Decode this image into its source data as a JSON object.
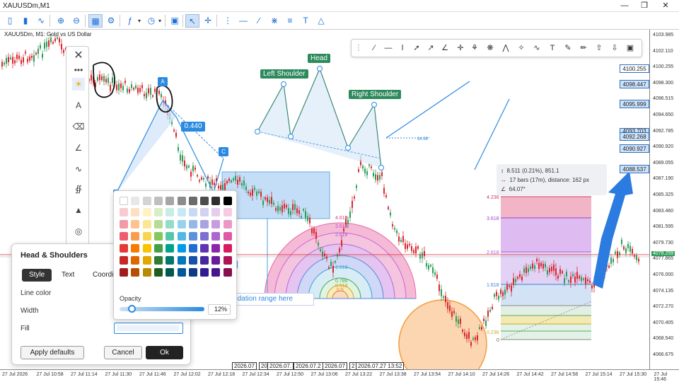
{
  "window": {
    "title": "XAUUSDm,M1"
  },
  "chart": {
    "title": "XAUUSDm, M1:  Gold vs US Dollar"
  },
  "price_axis": {
    "labels": [
      "4103.985",
      "4102.110",
      "4100.255",
      "4098.300",
      "4096.515",
      "4094.650",
      "4092.785",
      "4090.920",
      "4089.055",
      "4087.190",
      "4085.325",
      "4083.460",
      "4081.595",
      "4079.730",
      "4077.865",
      "4076.000",
      "4074.135",
      "4072.270",
      "4070.405",
      "4068.540",
      "4066.675"
    ]
  },
  "price_tags": [
    "4100.255",
    "4098.447",
    "4095.999",
    "4093.703",
    "4092.268",
    "4090.927",
    "4088.537"
  ],
  "current_price": "4078.259",
  "time_axis": {
    "labels": [
      "27 Jul 2026",
      "27 Jul 10:58",
      "27 Jul 11:14",
      "27 Jul 11:30",
      "27 Jul 11:46",
      "27 Jul 12:02",
      "27 Jul 12:18",
      "27 Jul 12:34",
      "27 Jul 12:50",
      "27 Jul 13:06",
      "27 Jul 13:22",
      "27 Jul 13:38",
      "27 Jul 13:54",
      "27 Jul 14:10",
      "27 Jul 14:26",
      "27 Jul 14:42",
      "27 Jul 14:58",
      "27 Jul 15:14",
      "27 Jul 15:30",
      "27 Jul 15:46"
    ],
    "boxes": [
      "2026.07",
      "20",
      "2026.07.",
      "2026.07.2",
      "2026.07",
      "2",
      "2026.07.27 13:52"
    ]
  },
  "pattern": {
    "head": "Head",
    "left_shoulder": "Left Shoulder",
    "right_shoulder": "Right Shoulder",
    "angle": "34.39°"
  },
  "abcd": {
    "a": "A",
    "c": "C",
    "value": "0.440"
  },
  "consolidation": "nsolidation range here",
  "fib_arcs": [
    "4.618",
    "3.618",
    "2.618",
    "1.618",
    "1.618",
    "0.786",
    "0.618",
    "0.5",
    "0.382"
  ],
  "fib_levels": {
    "labels": [
      "4.236",
      "3.618",
      "2.618",
      "1.618",
      "0.236",
      "0"
    ],
    "colors": [
      "#e8a0b4",
      "#c9a6e8",
      "#d5b8f0",
      "#cfe0f5",
      "#e8e0a0",
      "#d8efe0"
    ]
  },
  "measure": {
    "line1": "8.511 (0.21%), 851.1",
    "line2": "17 bars (17m), distance: 162 px",
    "line3": "64.07°"
  },
  "dialog": {
    "title": "Head & Shoulders",
    "tabs": [
      "Style",
      "Text",
      "Coordi"
    ],
    "line_color": "Line color",
    "width": "Width",
    "fill": "Fill",
    "apply_defaults": "Apply defaults",
    "cancel": "Cancel",
    "ok": "Ok"
  },
  "colorpicker": {
    "opacity_label": "Opacity",
    "opacity_value": "12%",
    "opacity_fraction": 0.12,
    "grays": [
      "#ffffff",
      "#e8e8e8",
      "#d4d4d4",
      "#bfbfbf",
      "#a6a6a6",
      "#8c8c8c",
      "#6b6b6b",
      "#4d4d4d",
      "#2e2e2e",
      "#000000"
    ],
    "palette": [
      [
        "#f8cbd0",
        "#fde0c4",
        "#fdf3c4",
        "#d8eec8",
        "#c8ede4",
        "#c8e8f5",
        "#c8daf3",
        "#d3d0f0",
        "#e4cdef",
        "#f4cbe2"
      ],
      [
        "#f29aa6",
        "#fbc38f",
        "#fbe693",
        "#b4dc96",
        "#94dcc8",
        "#96d3ed",
        "#96b8e8",
        "#aaa3e2",
        "#c99ce0",
        "#ea98c6"
      ],
      [
        "#ee5c6d",
        "#f89c4d",
        "#f8d44f",
        "#86c75c",
        "#56c6a8",
        "#54b8e4",
        "#5a93dc",
        "#7a6fd2",
        "#ab66cf",
        "#de5aa6"
      ],
      [
        "#e53935",
        "#f57c00",
        "#f9c400",
        "#43a047",
        "#00a388",
        "#039be5",
        "#1e6fd0",
        "#5e35b1",
        "#8e24aa",
        "#d81b60"
      ],
      [
        "#c62828",
        "#e06600",
        "#e0a800",
        "#2e7d32",
        "#00796b",
        "#0277bd",
        "#1552a8",
        "#4527a0",
        "#6a1b9a",
        "#ad1457"
      ],
      [
        "#a11d1d",
        "#b84f00",
        "#b88a00",
        "#1b5e20",
        "#00594f",
        "#01579b",
        "#0d3c80",
        "#311b92",
        "#4a148c",
        "#880e4f"
      ]
    ]
  },
  "colors": {
    "candle_up": "#2e9d5a",
    "candle_down": "#d8272d",
    "pattern": "#5ba4e6",
    "accent": "#2b8ae0"
  }
}
